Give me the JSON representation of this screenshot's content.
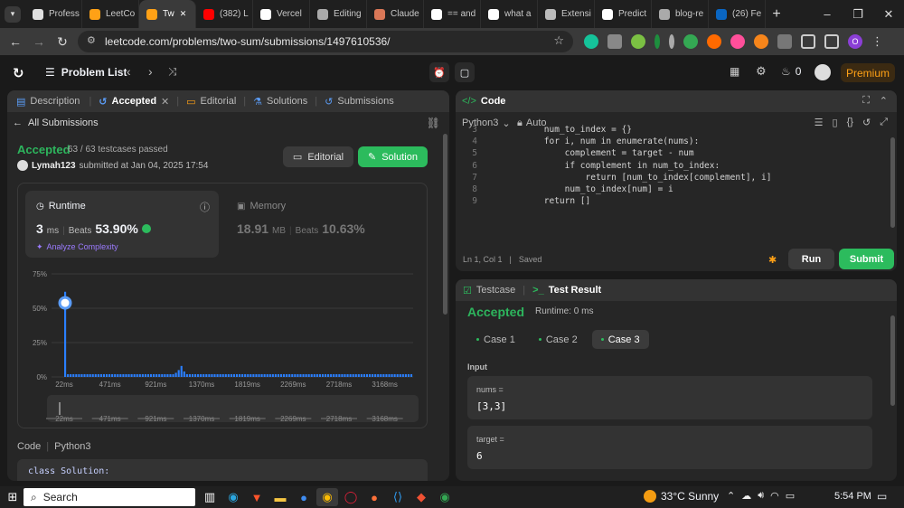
{
  "browser": {
    "tabs": [
      {
        "label": "Profess",
        "icon": "globe-icon",
        "color": "#e0e0e0"
      },
      {
        "label": "LeetCo",
        "icon": "leetcode-icon",
        "color": "#ffa116"
      },
      {
        "label": "Tw",
        "icon": "leetcode-icon",
        "color": "#ffa116",
        "active": true
      },
      {
        "label": "(382) L",
        "icon": "youtube-icon",
        "color": "#ff0000"
      },
      {
        "label": "Vercel",
        "icon": "vercel-icon",
        "color": "#ffffff"
      },
      {
        "label": "Editing",
        "icon": "github-icon",
        "color": "#aaaaaa"
      },
      {
        "label": "Claude",
        "icon": "claude-icon",
        "color": "#d97757"
      },
      {
        "label": "== and",
        "icon": "google-icon",
        "color": "#ffffff"
      },
      {
        "label": "what a",
        "icon": "google-icon",
        "color": "#ffffff"
      },
      {
        "label": "Extensi",
        "icon": "puzzle-icon",
        "color": "#bbbbbb"
      },
      {
        "label": "Predict",
        "icon": "dev-icon",
        "color": "#ffffff"
      },
      {
        "label": "blog-re",
        "icon": "github-icon",
        "color": "#aaaaaa"
      },
      {
        "label": "(26) Fe",
        "icon": "linkedin-icon",
        "color": "#0a66c2"
      }
    ],
    "new_tab": "+",
    "url": "leetcode.com/problems/two-sum/submissions/1497610536/",
    "profile_initial": "O"
  },
  "lc_nav": {
    "problem_list": "Problem List",
    "streak": "0",
    "premium": "Premium"
  },
  "left_tabs": {
    "description": "Description",
    "accepted": "Accepted",
    "editorial": "Editorial",
    "solutions": "Solutions",
    "submissions": "Submissions"
  },
  "submission": {
    "all_submissions": "All Submissions",
    "status": "Accepted",
    "passed": "63 / 63 testcases passed",
    "user": "Lymah123",
    "submitted": "submitted at Jan 04, 2025 17:54",
    "editorial_btn": "Editorial",
    "solution_btn": "Solution"
  },
  "runtime": {
    "label": "Runtime",
    "value": "3",
    "unit": "ms",
    "beats_label": "Beats",
    "beats": "53.90%",
    "analyze": "Analyze Complexity"
  },
  "memory": {
    "label": "Memory",
    "value": "18.91",
    "unit": "MB",
    "beats_label": "Beats",
    "beats": "10.63%"
  },
  "chart_data": {
    "type": "bar",
    "title": "",
    "xlabel": "",
    "ylabel": "",
    "ylim": [
      0,
      75
    ],
    "yticks": [
      "75%",
      "50%",
      "25%",
      "0%"
    ],
    "xticks": [
      "22ms",
      "471ms",
      "921ms",
      "1370ms",
      "1819ms",
      "2269ms",
      "2718ms",
      "3168ms"
    ],
    "selected": {
      "x": "22ms",
      "y": 53.9
    },
    "values": [
      62,
      2,
      2,
      2,
      2,
      2,
      2,
      2,
      2,
      2,
      2,
      2,
      2,
      2,
      2,
      2,
      2,
      2,
      2,
      2,
      2,
      2,
      2,
      2,
      2,
      2,
      2,
      2,
      2,
      2,
      2,
      2,
      2,
      2,
      2,
      2,
      2,
      2,
      2,
      2,
      3,
      5,
      8,
      4,
      2,
      2,
      2,
      2,
      2,
      2,
      2,
      2,
      2,
      2,
      2,
      2,
      2,
      2,
      2,
      2,
      2,
      2,
      2,
      2,
      2,
      2,
      2,
      2,
      2,
      2,
      2,
      2,
      2,
      2,
      2,
      2,
      2,
      2,
      2,
      2,
      2,
      2,
      2,
      2,
      2,
      2,
      2,
      2,
      2,
      2,
      2,
      2,
      2,
      2,
      2,
      2,
      2,
      2,
      2,
      2,
      2,
      2,
      2,
      2,
      2,
      2,
      2,
      2,
      2,
      2,
      2,
      2,
      2,
      2,
      2,
      2,
      2,
      2,
      2,
      2,
      2,
      2,
      2,
      2,
      2,
      2
    ],
    "bar_color": "#2a7fff"
  },
  "code_section": {
    "label": "Code",
    "lang": "Python3",
    "first_line": "class Solution:"
  },
  "editor": {
    "title": "Code",
    "lang": "Python3",
    "auto": "Auto",
    "lines": [
      {
        "n": "3",
        "t": "        num_to_index = {}"
      },
      {
        "n": "4",
        "t": "        for i, num in enumerate(nums):"
      },
      {
        "n": "5",
        "t": "            complement = target - num"
      },
      {
        "n": "6",
        "t": "            if complement in num_to_index:"
      },
      {
        "n": "7",
        "t": "                return [num_to_index[complement], i]"
      },
      {
        "n": "8",
        "t": "            num_to_index[num] = i"
      },
      {
        "n": "9",
        "t": "        return []"
      }
    ],
    "status_pos": "Ln 1, Col 1",
    "status_saved": "Saved",
    "run": "Run",
    "submit": "Submit"
  },
  "result": {
    "testcase_tab": "Testcase",
    "result_tab": "Test Result",
    "status": "Accepted",
    "runtime": "Runtime: 0 ms",
    "cases": [
      "Case 1",
      "Case 2",
      "Case 3"
    ],
    "input_label": "Input",
    "nums_label": "nums =",
    "nums_value": "[3,3]",
    "target_label": "target =",
    "target_value": "6"
  },
  "taskbar": {
    "search": "Search",
    "weather": "33°C  Sunny",
    "time": "5:54 PM"
  }
}
